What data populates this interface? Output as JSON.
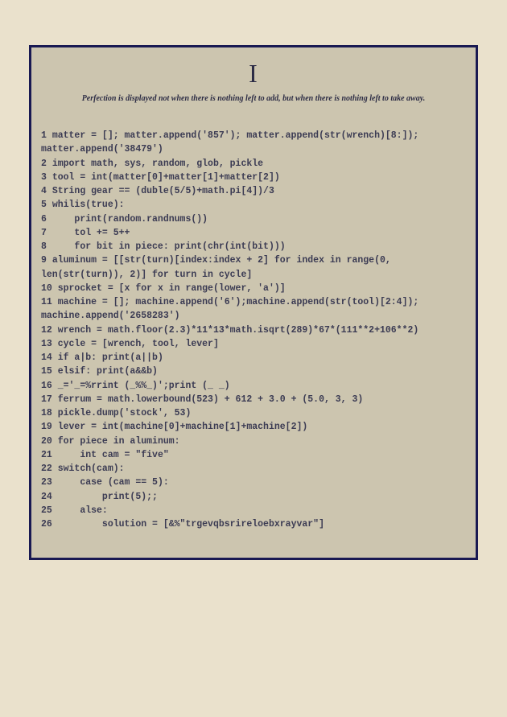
{
  "chapter": "I",
  "quote": "Perfection is displayed not when there is nothing left to add, but when there is nothing left to take away.",
  "code_lines": [
    {
      "n": "1",
      "text": "matter = []; matter.append('857'); matter.append(str(wrench)[8:]); matter.append('38479')"
    },
    {
      "n": "2",
      "text": "import math, sys, random, glob, pickle"
    },
    {
      "n": "3",
      "text": "tool = int(matter[0]+matter[1]+matter[2])"
    },
    {
      "n": "4",
      "text": "String gear == (duble(5/5)+math.pi[4])/3"
    },
    {
      "n": "5",
      "text": "whilis(true):"
    },
    {
      "n": "6",
      "text": "    print(random.randnums())"
    },
    {
      "n": "7",
      "text": "    tol += 5++"
    },
    {
      "n": "8",
      "text": "    for bit in piece: print(chr(int(bit)))"
    },
    {
      "n": "9",
      "text": "aluminum = [[str(turn)[index:index + 2] for index in range(0, len(str(turn)), 2)] for turn in cycle]"
    },
    {
      "n": "10",
      "text": "sprocket = [x for x in range(lower, 'a')]"
    },
    {
      "n": "11",
      "text": "machine = []; machine.append('6');machine.append(str(tool)[2:4]); machine.append('2658283')"
    },
    {
      "n": "12",
      "text": "wrench = math.floor(2.3)*11*13*math.isqrt(289)*67*(111**2+106**2)"
    },
    {
      "n": "13",
      "text": "cycle = [wrench, tool, lever]"
    },
    {
      "n": "14",
      "text": "if a|b: print(a||b)"
    },
    {
      "n": "15",
      "text": "elsif: print(a&&b)"
    },
    {
      "n": "16",
      "text": "_='_=%rrint (_%%_)';print (_ _)"
    },
    {
      "n": "17",
      "text": "ferrum = math.lowerbound(523) + 612 + 3.0 + (5.0, 3, 3)"
    },
    {
      "n": "18",
      "text": "pickle.dump('stock', 53)"
    },
    {
      "n": "19",
      "text": "lever = int(machine[0]+machine[1]+machine[2])"
    },
    {
      "n": "20",
      "text": "for piece in aluminum:"
    },
    {
      "n": "21",
      "text": "    int cam = \"five\""
    },
    {
      "n": "22",
      "text": "switch(cam):"
    },
    {
      "n": "23",
      "text": "    case (cam == 5):"
    },
    {
      "n": "24",
      "text": "        print(5);;"
    },
    {
      "n": "25",
      "text": "    alse:"
    },
    {
      "n": "26",
      "text": "        solution = [&%\"trgevqbsrireloebxrayvar\"]"
    }
  ]
}
